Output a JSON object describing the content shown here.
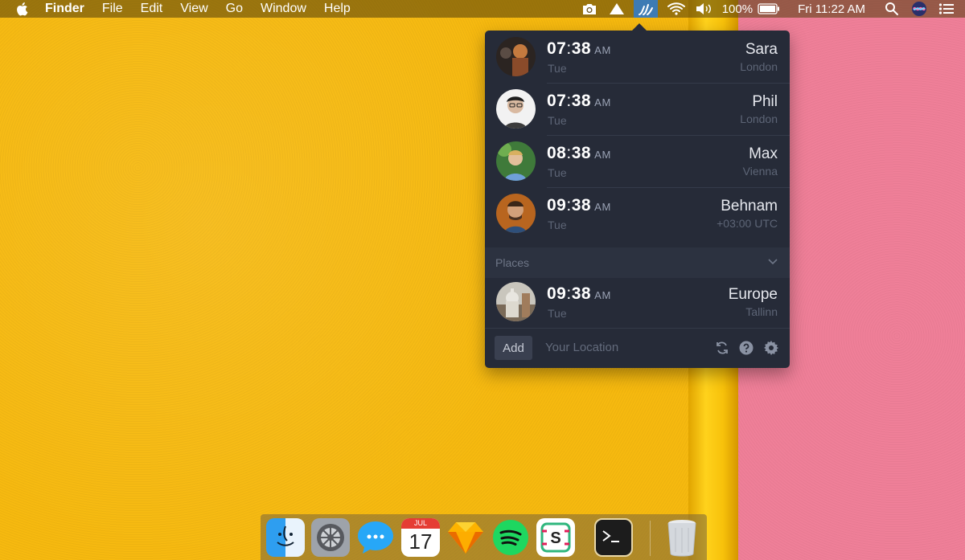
{
  "menubar": {
    "app_name": "Finder",
    "menus": [
      "File",
      "Edit",
      "View",
      "Go",
      "Window",
      "Help"
    ],
    "battery": "100%",
    "clock": "Fri 11:22 AM",
    "icons": [
      "camera-icon",
      "drive-triangle-icon",
      "timezone-app-icon",
      "wifi-icon",
      "volume-icon",
      "battery-icon",
      "spotlight-search-icon",
      "siri-icon",
      "notification-center-icon"
    ]
  },
  "popover": {
    "people": [
      {
        "hour": "07",
        "minute": "38",
        "ampm": "AM",
        "day": "Tue",
        "name": "Sara",
        "location": "London"
      },
      {
        "hour": "07",
        "minute": "38",
        "ampm": "AM",
        "day": "Tue",
        "name": "Phil",
        "location": "London"
      },
      {
        "hour": "08",
        "minute": "38",
        "ampm": "AM",
        "day": "Tue",
        "name": "Max",
        "location": "Vienna"
      },
      {
        "hour": "09",
        "minute": "38",
        "ampm": "AM",
        "day": "Tue",
        "name": "Behnam",
        "location": "+03:00 UTC"
      }
    ],
    "places_label": "Places",
    "places": [
      {
        "hour": "09",
        "minute": "38",
        "ampm": "AM",
        "day": "Tue",
        "name": "Europe",
        "location": "Tallinn"
      }
    ],
    "footer": {
      "add_label": "Add",
      "location_placeholder": "Your Location"
    }
  },
  "dock": {
    "apps": [
      "finder-icon",
      "system-preferences-icon",
      "messages-icon",
      "calendar-icon",
      "sketch-icon",
      "spotify-icon",
      "slack-icon",
      "terminal-icon",
      "trash-icon"
    ],
    "calendar_month": "JUL",
    "calendar_day": "17"
  }
}
